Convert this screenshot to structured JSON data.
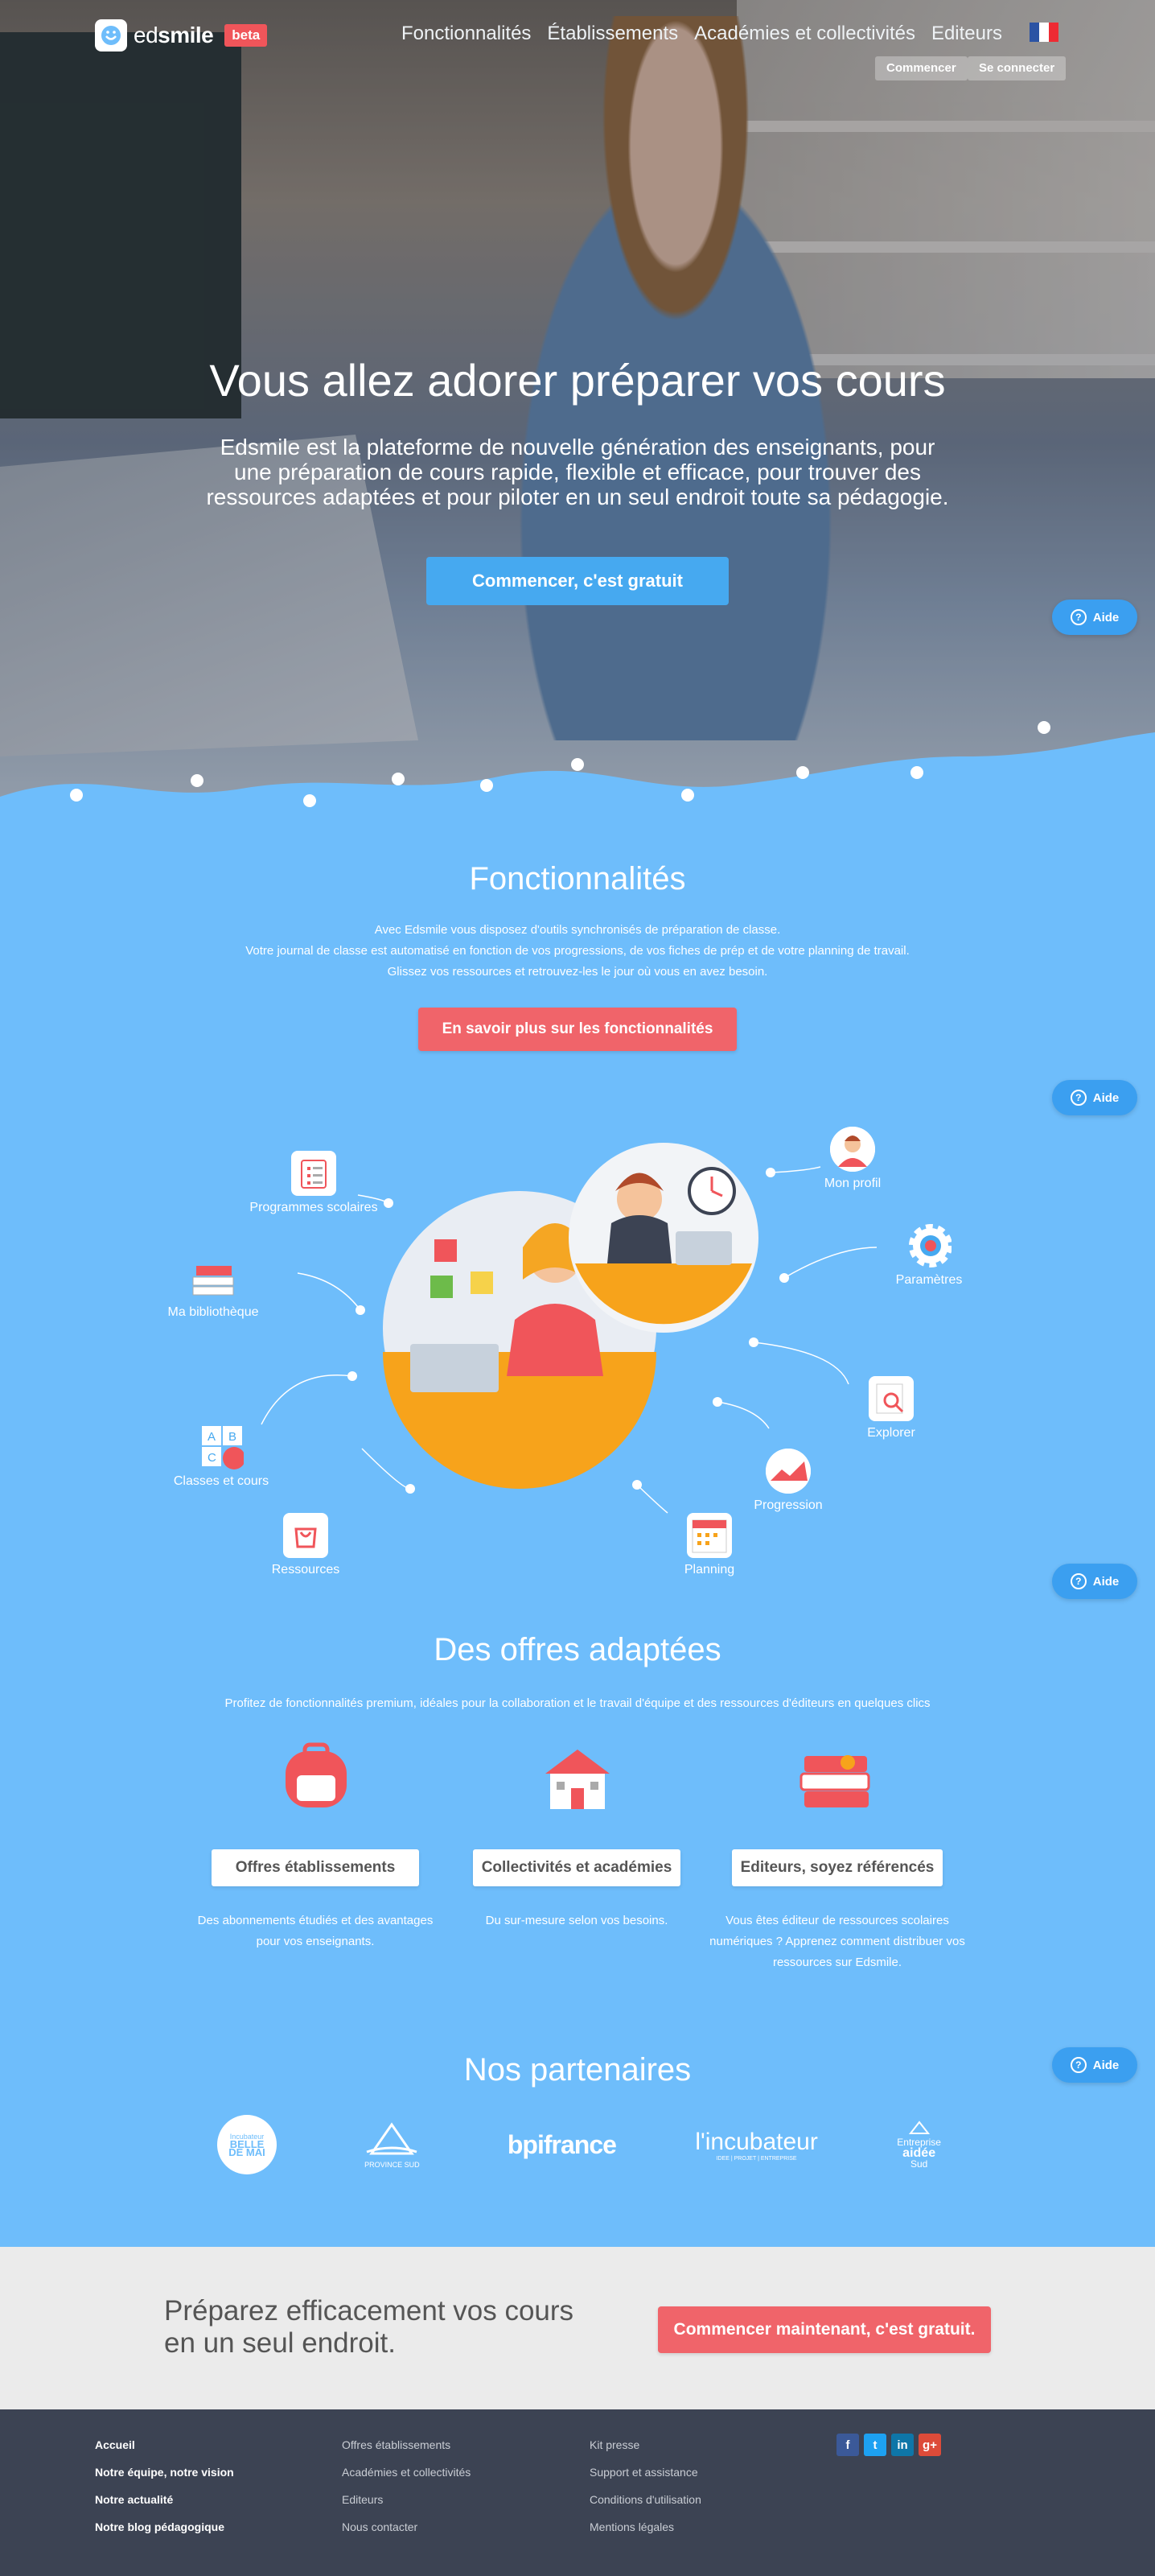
{
  "brand": {
    "logo_text_light": "ed",
    "logo_text_bold": "smile",
    "badge": "beta"
  },
  "nav": {
    "items": [
      "Fonctionnalités",
      "Établissements",
      "Académies et collectivités",
      "Editeurs"
    ],
    "start_button": "Commencer",
    "login_button": "Se connecter",
    "flag_colors": [
      "#2b53a4",
      "#ffffff",
      "#ee2b33"
    ]
  },
  "hero": {
    "title": "Vous allez adorer préparer vos cours",
    "subtitle": "Edsmile est la plateforme de nouvelle génération des enseignants, pour une préparation de cours rapide, flexible et efficace, pour trouver des ressources adaptées et pour piloter en un seul endroit toute sa pédagogie.",
    "cta": "Commencer, c'est gratuit"
  },
  "help": {
    "label": "Aide",
    "icon": "question-icon"
  },
  "features": {
    "title": "Fonctionnalités",
    "lines": [
      "Avec Edsmile vous disposez d'outils synchronisés de préparation de classe.",
      "Votre journal de classe est automatisé en fonction de vos progressions, de vos fiches de prép et de votre planning de travail.",
      "Glissez vos ressources et retrouvez-les le jour où vous en avez besoin."
    ],
    "button": "En savoir plus sur les fonctionnalités",
    "items": [
      {
        "label": "Programmes scolaires",
        "icon": "clipboard-icon"
      },
      {
        "label": "Ma bibliothèque",
        "icon": "books-icon"
      },
      {
        "label": "Classes et cours",
        "icon": "abc-blocks-icon"
      },
      {
        "label": "Ressources",
        "icon": "bag-icon"
      },
      {
        "label": "Planning",
        "icon": "calendar-icon"
      },
      {
        "label": "Progression",
        "icon": "chart-icon"
      },
      {
        "label": "Explorer",
        "icon": "magnifier-icon"
      },
      {
        "label": "Paramètres",
        "icon": "gear-icon"
      },
      {
        "label": "Mon profil",
        "icon": "profile-icon"
      }
    ]
  },
  "offers": {
    "title": "Des offres adaptées",
    "subtitle": "Profitez de fonctionnalités premium, idéales pour la collaboration et le travail d'équipe et des ressources d'éditeurs en quelques clics",
    "items": [
      {
        "button": "Offres établissements",
        "text": "Des abonnements étudiés et des avantages pour vos enseignants.",
        "icon": "backpack-icon"
      },
      {
        "button": "Collectivités et académies",
        "text": "Du sur-mesure selon vos besoins.",
        "icon": "school-building-icon"
      },
      {
        "button": "Editeurs, soyez référencés",
        "text": "Vous êtes éditeur de ressources scolaires numériques ? Apprenez comment distribuer vos ressources sur Edsmile.",
        "icon": "book-stack-icon"
      }
    ]
  },
  "partners": {
    "title": "Nos partenaires",
    "items": [
      {
        "name": "Incubateur Belle de Mai",
        "line1": "Incubateur",
        "line2": "BELLE",
        "line3": "DE MAI"
      },
      {
        "name": "Province Sud",
        "line1": "PROVINCE SUD"
      },
      {
        "name": "bpifrance",
        "line1": "bpifrance"
      },
      {
        "name": "l'incubateur",
        "line1": "l'incubateur",
        "line2": "IDEE | PROJET | ENTREPRISE"
      },
      {
        "name": "Entreprise aidée Province Sud",
        "line1": "Entreprise",
        "line2": "aidée",
        "line3": "Sud"
      }
    ]
  },
  "cta_band": {
    "line1": "Préparez efficacement vos cours",
    "line2": "en un seul endroit.",
    "button": "Commencer maintenant, c'est gratuit."
  },
  "footer": {
    "col1": [
      "Accueil",
      "Notre équipe, notre vision",
      "Notre actualité",
      "Notre blog pédagogique"
    ],
    "col2": [
      "Offres établissements",
      "Académies et collectivités",
      "Editeurs",
      "Nous contacter"
    ],
    "col3": [
      "Kit presse",
      "Support et assistance",
      "Conditions d'utilisation",
      "Mentions légales"
    ],
    "social": [
      {
        "label": "f",
        "icon": "facebook-icon",
        "color": "#3b5998"
      },
      {
        "label": "t",
        "icon": "twitter-icon",
        "color": "#1da1f2"
      },
      {
        "label": "in",
        "icon": "linkedin-icon",
        "color": "#0e76a8"
      },
      {
        "label": "g+",
        "icon": "google-plus-icon",
        "color": "#dd4b39"
      }
    ]
  },
  "colors": {
    "sky": "#6ebdfb",
    "accent_red": "#f0646a",
    "accent_blue": "#46a9f0",
    "footer": "#3c4353"
  }
}
